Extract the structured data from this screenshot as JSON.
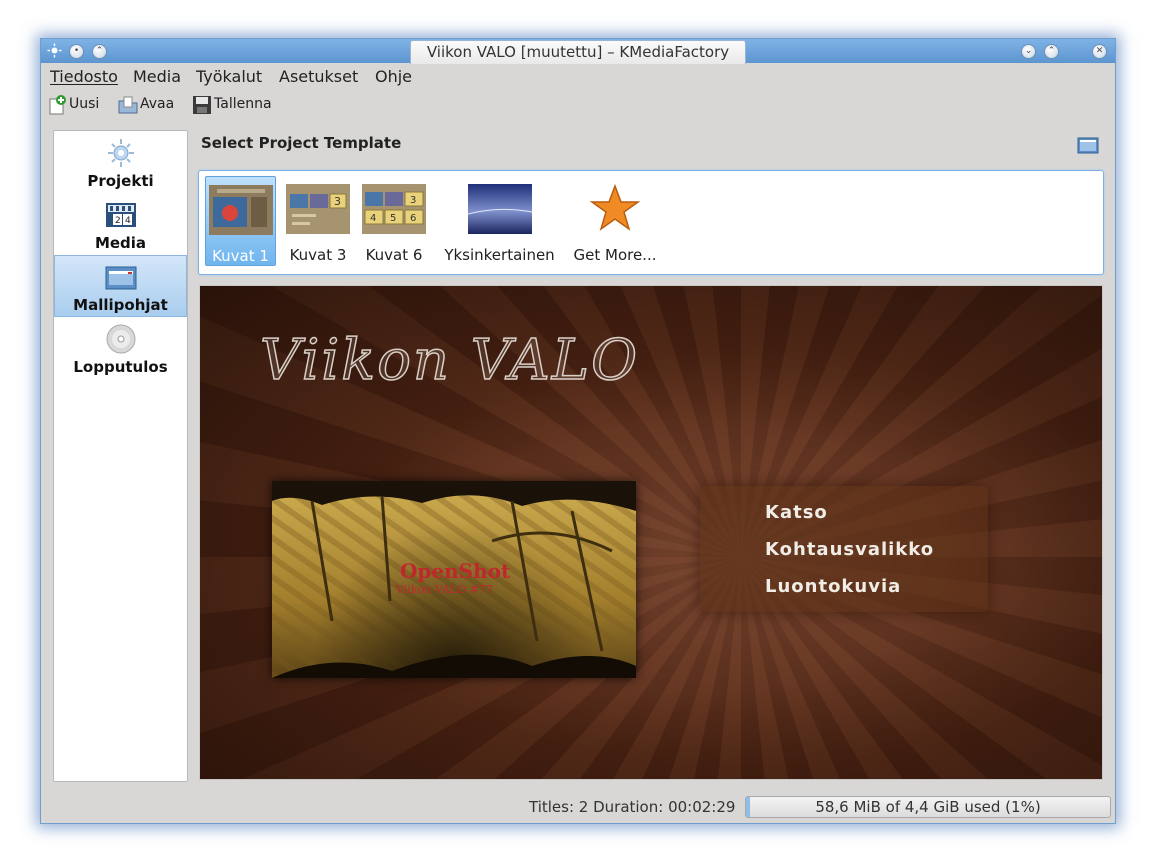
{
  "window": {
    "title": "Viikon VALO [muutettu] – KMediaFactory",
    "buttons": [
      "minimize",
      "maximize",
      "close"
    ]
  },
  "menubar": {
    "items": [
      {
        "label": "Tiedosto"
      },
      {
        "label": "Media"
      },
      {
        "label": "Työkalut"
      },
      {
        "label": "Asetukset"
      },
      {
        "label": "Ohje"
      }
    ]
  },
  "toolbar": {
    "new_label": "Uusi",
    "open_label": "Avaa",
    "save_label": "Tallenna"
  },
  "sidebar": {
    "items": [
      {
        "label": "Projekti",
        "icon": "project-icon"
      },
      {
        "label": "Media",
        "icon": "media-icon"
      },
      {
        "label": "Mallipohjat",
        "icon": "templates-icon",
        "selected": true
      },
      {
        "label": "Lopputulos",
        "icon": "disc-icon"
      }
    ]
  },
  "main": {
    "section_title": "Select Project Template",
    "templates": [
      {
        "label": "Kuvat 1",
        "selected": true
      },
      {
        "label": "Kuvat 3"
      },
      {
        "label": "Kuvat 6"
      },
      {
        "label": "Yksinkertainen"
      },
      {
        "label": "Get More..."
      }
    ],
    "thumb_numbers": {
      "kuvat3": "3",
      "kuvat6": [
        "3",
        "4",
        "5",
        "6"
      ]
    },
    "preview": {
      "title": "Viikon VALO",
      "photo_title": "OpenShot",
      "photo_subtitle": "Viikon VALO #77",
      "menu_entries": [
        "Katso",
        "Kohtausvalikko",
        "Luontokuvia"
      ]
    }
  },
  "statusbar": {
    "info": "Titles: 2 Duration: 00:02:29",
    "usage": "58,6 MiB of 4,4 GiB used (1%)",
    "usage_fraction": 0.01
  },
  "colors": {
    "accent": "#5d95d0",
    "selection": "#6fb5ee",
    "preview_bg": "#4a2212",
    "photo_text": "#c0272d"
  }
}
